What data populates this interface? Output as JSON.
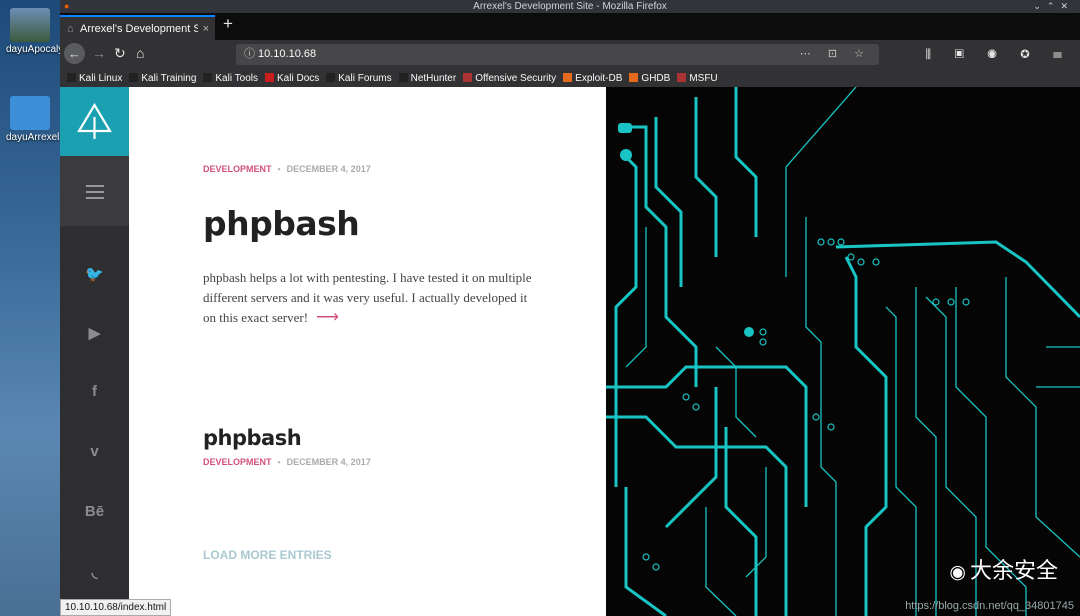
{
  "desktop": {
    "icons": [
      {
        "label": "dayuApocalyst",
        "color": "#4a7a4a"
      },
      {
        "label": "dayuArrexel",
        "color": "#3d8fd8"
      }
    ]
  },
  "browser": {
    "window_title": "Arrexel's Development Site - Mozilla Firefox",
    "tab_title": "Arrexel's Development Site",
    "tab_close": "×",
    "new_tab": "+",
    "url": "10.10.10.68",
    "bookmarks": [
      {
        "label": "Kali Linux",
        "color": "#222"
      },
      {
        "label": "Kali Training",
        "color": "#222"
      },
      {
        "label": "Kali Tools",
        "color": "#222"
      },
      {
        "label": "Kali Docs",
        "color": "#c81e1e"
      },
      {
        "label": "Kali Forums",
        "color": "#222"
      },
      {
        "label": "NetHunter",
        "color": "#222"
      },
      {
        "label": "Offensive Security",
        "color": "#a33"
      },
      {
        "label": "Exploit-DB",
        "color": "#e56a1d"
      },
      {
        "label": "GHDB",
        "color": "#e56a1d"
      },
      {
        "label": "MSFU",
        "color": "#a33"
      }
    ],
    "status_url": "10.10.10.68/index.html"
  },
  "site": {
    "accent": "#1aa0b0",
    "social": [
      {
        "name": "twitter-icon",
        "glyph": "🐦"
      },
      {
        "name": "youtube-icon",
        "glyph": "▶"
      },
      {
        "name": "facebook-icon",
        "glyph": "f"
      },
      {
        "name": "vimeo-icon",
        "glyph": "v"
      },
      {
        "name": "behance-icon",
        "glyph": "Bē"
      },
      {
        "name": "rss-icon",
        "glyph": "◟"
      }
    ],
    "post1": {
      "category": "DEVELOPMENT",
      "date": "DECEMBER 4, 2017",
      "title": "phpbash",
      "excerpt": "phpbash helps a lot with pentesting. I have tested it on multiple different servers and it was very useful. I actually developed it on this exact server!"
    },
    "post2": {
      "category": "DEVELOPMENT",
      "date": "DECEMBER 4, 2017",
      "title": "phpbash"
    },
    "load_more": "LOAD MORE ENTRIES"
  },
  "watermark": {
    "text": "大余安全",
    "url": "https://blog.csdn.net/qq_34801745"
  }
}
